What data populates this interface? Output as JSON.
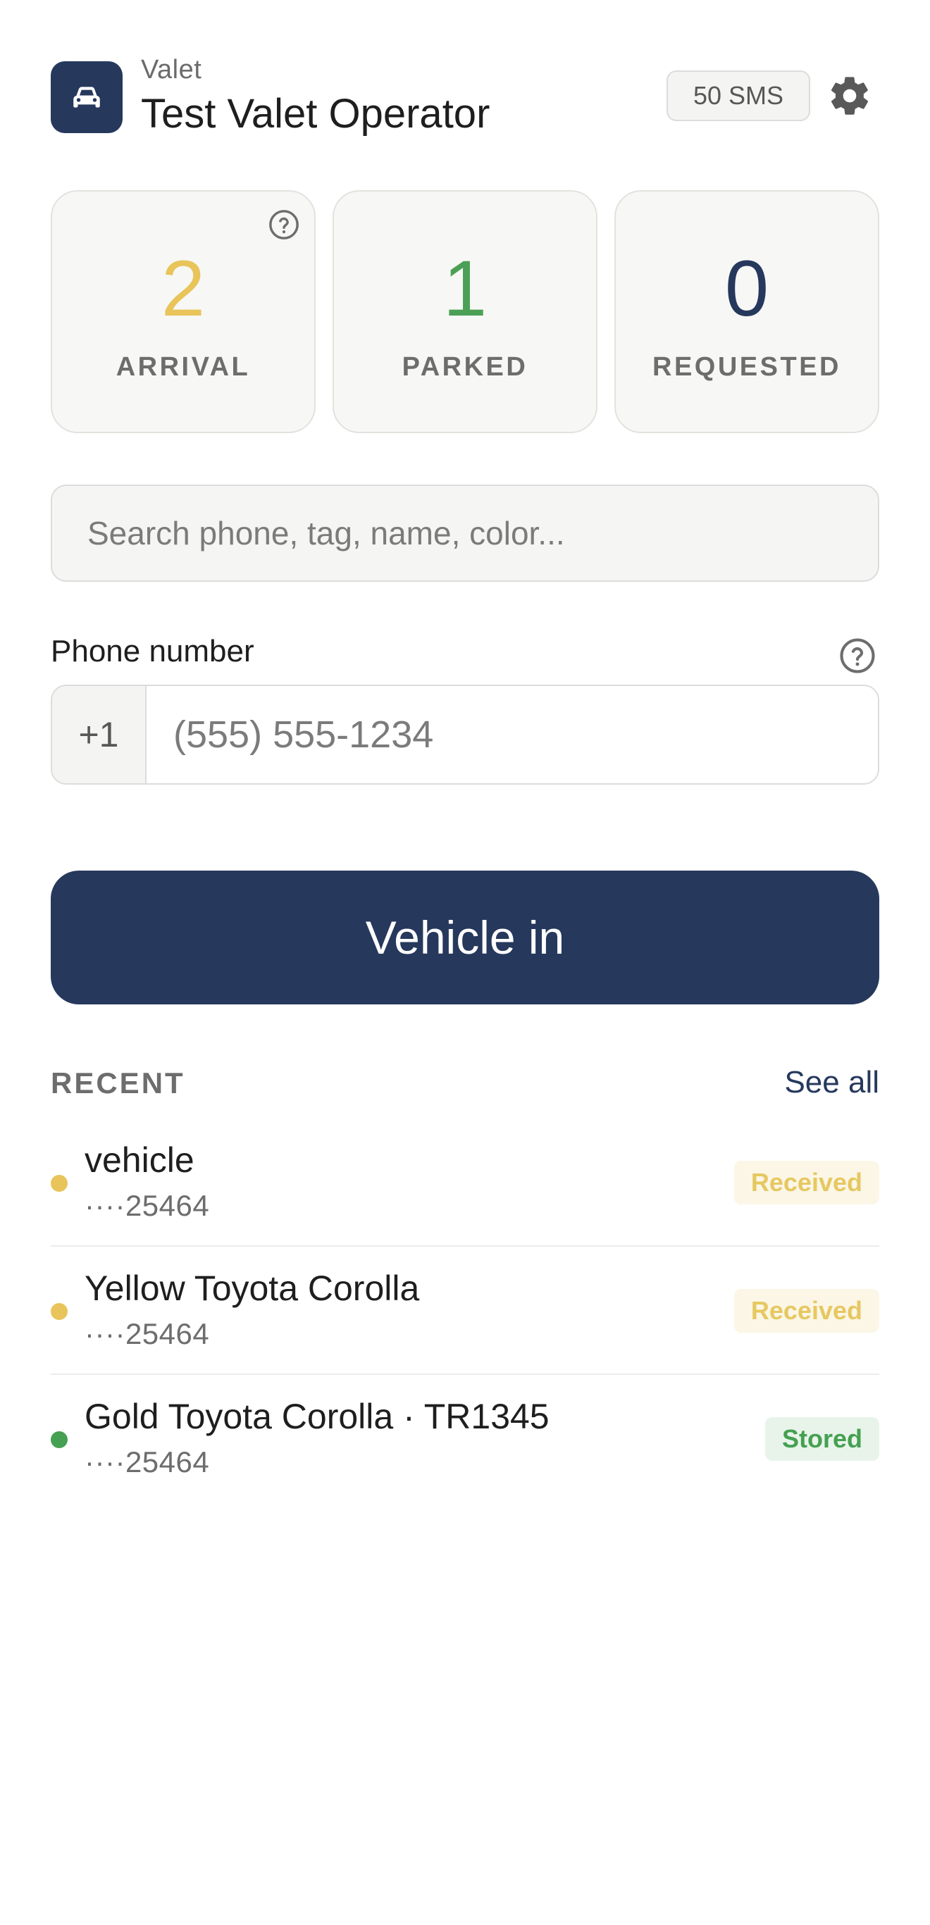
{
  "header": {
    "kicker": "Valet",
    "operator_name": "Test Valet Operator",
    "sms_badge": "50 SMS",
    "logo_icon": "car-icon",
    "settings_icon": "gear-icon"
  },
  "stats": [
    {
      "value": "2",
      "label": "ARRIVAL",
      "color": "#E8C45A",
      "has_help": true
    },
    {
      "value": "1",
      "label": "PARKED",
      "color": "#4BA055",
      "has_help": false
    },
    {
      "value": "0",
      "label": "REQUESTED",
      "color": "#26385C",
      "has_help": false
    }
  ],
  "search": {
    "placeholder": "Search phone, tag, name, color...",
    "value": ""
  },
  "phone": {
    "label": "Phone number",
    "country_code": "+1",
    "placeholder": "(555) 555-1234",
    "value": "",
    "help_icon": "help-circle-icon"
  },
  "primary_action": {
    "label": "Vehicle in"
  },
  "recent": {
    "heading": "RECENT",
    "see_all": "See all",
    "items": [
      {
        "title": "vehicle",
        "subtitle": "····25464",
        "status": "Received",
        "dot_color": "#E8C45A"
      },
      {
        "title": "Yellow Toyota Corolla",
        "subtitle": "····25464",
        "status": "Received",
        "dot_color": "#E8C45A"
      },
      {
        "title": "Gold Toyota Corolla · TR1345",
        "subtitle": "····25464",
        "status": "Stored",
        "dot_color": "#45A052"
      }
    ]
  },
  "colors": {
    "brand": "#26385C",
    "arrival": "#E8C45A",
    "parked": "#4BA055",
    "muted_text": "#6D6D6D"
  }
}
